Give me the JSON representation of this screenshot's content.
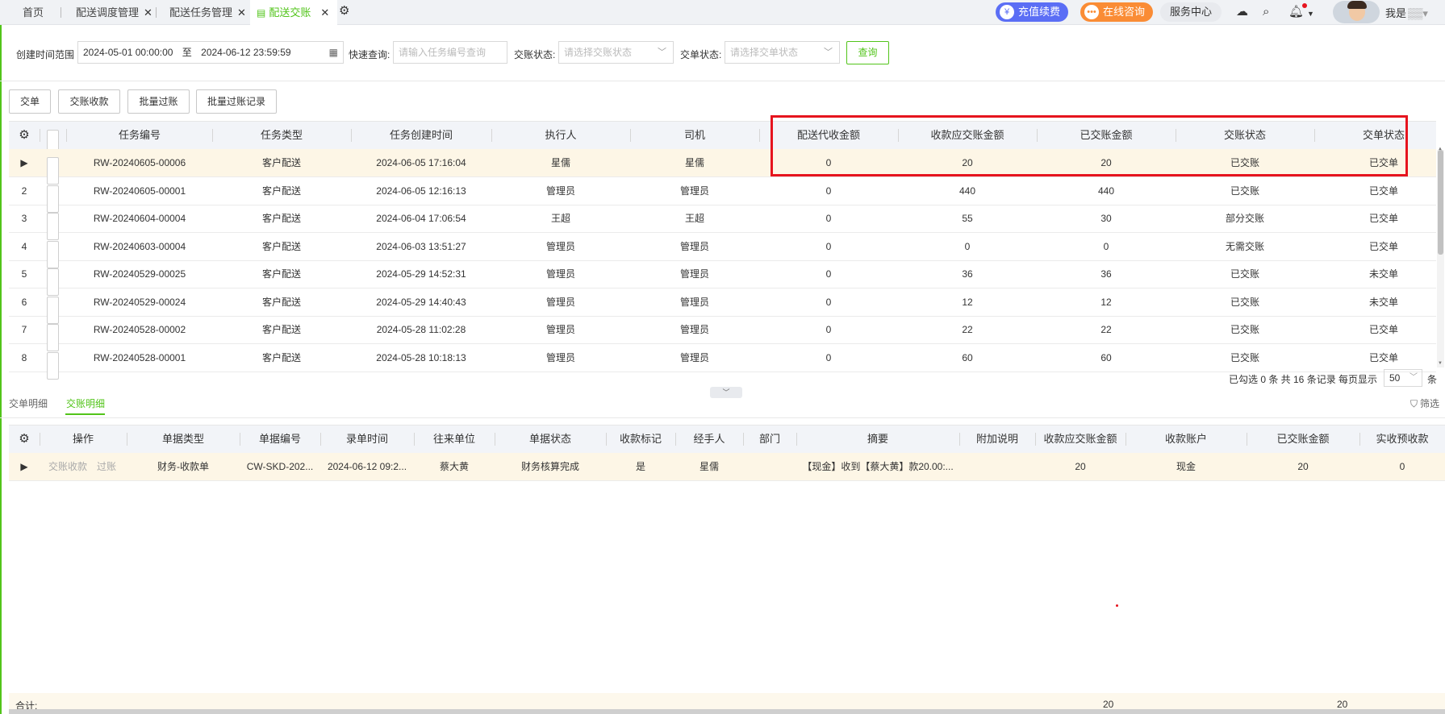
{
  "tabs": [
    {
      "label": "首页"
    },
    {
      "label": "配送调度管理"
    },
    {
      "label": "配送任务管理"
    },
    {
      "label": "配送交账"
    }
  ],
  "topright": {
    "recharge": "充值续费",
    "consult": "在线咨询",
    "service": "服务中心",
    "username": "我是"
  },
  "filters": {
    "date_label": "创建时间范围",
    "date_start": "2024-05-01 00:00:00",
    "date_to": "至",
    "date_end": "2024-06-12 23:59:59",
    "quick_label": "快速查询:",
    "quick_placeholder": "请输入任务编号查询",
    "acct_label": "交账状态:",
    "acct_placeholder": "请选择交账状态",
    "order_label": "交单状态:",
    "order_placeholder": "请选择交单状态",
    "query_btn": "查询"
  },
  "actions": [
    "交单",
    "交账收款",
    "批量过账",
    "批量过账记录"
  ],
  "main_table": {
    "headers": [
      "任务编号",
      "任务类型",
      "任务创建时间",
      "执行人",
      "司机",
      "配送代收金额",
      "收款应交账金额",
      "已交账金额",
      "交账状态",
      "交单状态"
    ],
    "rows": [
      {
        "no": "",
        "task": "RW-20240605-00006",
        "type": "客户配送",
        "time": "2024-06-05 17:16:04",
        "exec": "星儒",
        "driver": "星儒",
        "cod": "0",
        "due": "20",
        "paid": "20",
        "acct": "已交账",
        "order": "已交单"
      },
      {
        "no": "2",
        "task": "RW-20240605-00001",
        "type": "客户配送",
        "time": "2024-06-05 12:16:13",
        "exec": "管理员",
        "driver": "管理员",
        "cod": "0",
        "due": "440",
        "paid": "440",
        "acct": "已交账",
        "order": "已交单"
      },
      {
        "no": "3",
        "task": "RW-20240604-00004",
        "type": "客户配送",
        "time": "2024-06-04 17:06:54",
        "exec": "王超",
        "driver": "王超",
        "cod": "0",
        "due": "55",
        "paid": "30",
        "acct": "部分交账",
        "order": "已交单"
      },
      {
        "no": "4",
        "task": "RW-20240603-00004",
        "type": "客户配送",
        "time": "2024-06-03 13:51:27",
        "exec": "管理员",
        "driver": "管理员",
        "cod": "0",
        "due": "0",
        "paid": "0",
        "acct": "无需交账",
        "order": "已交单"
      },
      {
        "no": "5",
        "task": "RW-20240529-00025",
        "type": "客户配送",
        "time": "2024-05-29 14:52:31",
        "exec": "管理员",
        "driver": "管理员",
        "cod": "0",
        "due": "36",
        "paid": "36",
        "acct": "已交账",
        "order": "未交单"
      },
      {
        "no": "6",
        "task": "RW-20240529-00024",
        "type": "客户配送",
        "time": "2024-05-29 14:40:43",
        "exec": "管理员",
        "driver": "管理员",
        "cod": "0",
        "due": "12",
        "paid": "12",
        "acct": "已交账",
        "order": "未交单"
      },
      {
        "no": "7",
        "task": "RW-20240528-00002",
        "type": "客户配送",
        "time": "2024-05-28 11:02:28",
        "exec": "管理员",
        "driver": "管理员",
        "cod": "0",
        "due": "22",
        "paid": "22",
        "acct": "已交账",
        "order": "已交单"
      },
      {
        "no": "8",
        "task": "RW-20240528-00001",
        "type": "客户配送",
        "time": "2024-05-28 10:18:13",
        "exec": "管理员",
        "driver": "管理员",
        "cod": "0",
        "due": "60",
        "paid": "60",
        "acct": "已交账",
        "order": "已交单"
      }
    ]
  },
  "pager": {
    "summary": "已勾选 0 条  共 16 条记录  每页显示",
    "page_size": "50",
    "unit": "条"
  },
  "bottom_tabs": {
    "tab1": "交单明细",
    "tab2": "交账明细",
    "filter": "筛选"
  },
  "detail_table": {
    "headers": [
      "操作",
      "单据类型",
      "单据编号",
      "录单时间",
      "往来单位",
      "单据状态",
      "收款标记",
      "经手人",
      "部门",
      "摘要",
      "附加说明",
      "收款应交账金额",
      "收款账户",
      "已交账金额",
      "实收预收款"
    ],
    "row": {
      "op1": "交账收款",
      "op2": "过账",
      "type": "财务-收款单",
      "code": "CW-SKD-202...",
      "time": "2024-06-12 09:2...",
      "unit": "蔡大黄",
      "status": "财务核算完成",
      "flag": "是",
      "handler": "星儒",
      "dept": "",
      "summary": "【现金】收到【蔡大黄】款20.00:...",
      "note": "",
      "due": "20",
      "account": "现金",
      "paid": "20",
      "prepay": "0"
    }
  },
  "footer": {
    "label": "合计:",
    "due_total": "20",
    "paid_total": "20"
  },
  "colors": {
    "accent": "#52c41a",
    "highlight_box": "#e6141e",
    "recharge_pill": "#5b6ef5",
    "consult_pill": "#fa8c35"
  }
}
